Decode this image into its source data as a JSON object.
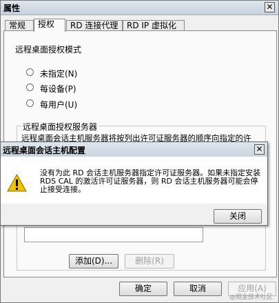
{
  "window": {
    "title": "属性",
    "close_glyph": "✕"
  },
  "tabs": [
    {
      "label": "常规"
    },
    {
      "label": "授权"
    },
    {
      "label": "RD 连接代理"
    },
    {
      "label": "RD IP 虚拟化"
    }
  ],
  "licensing": {
    "mode_heading": "远程桌面授权模式",
    "options": [
      {
        "label": "未指定(N)",
        "selected": false
      },
      {
        "label": "每设备(P)",
        "selected": false
      },
      {
        "label": "每用户(U)",
        "selected": false
      }
    ],
    "server_group": {
      "legend": "远程桌面授权服务器",
      "description": "远程桌面会话主机服务器将按列出许可证服务器的顺序向指定的许"
    },
    "add_label": "添加(D)...",
    "remove_label": "删除(R)"
  },
  "footer": {
    "ok_label": "确定",
    "cancel_label": "取消",
    "apply_label": "应用(A)"
  },
  "dialog": {
    "title": "远程桌面会话主机配置",
    "message": "没有为此 RD 会话主机服务器指定许可证服务器。如果未指定安装 RDS  CAL 的激活许可证服务器，则 RD 会话主机服务器可能会停止接受连接。",
    "close_label": "关闭",
    "icon": "warning-icon",
    "icon_color": "#f2c200",
    "close_glyph": "✕"
  },
  "watermark": "@掘金技术社区"
}
